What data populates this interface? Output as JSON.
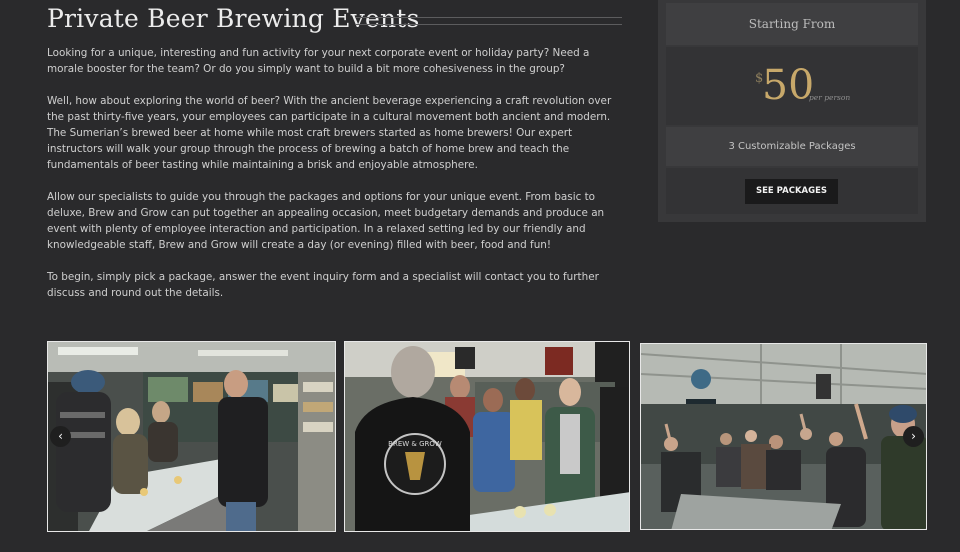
{
  "page": {
    "title": "Private Beer Brewing Events",
    "paragraphs": [
      "Looking for a unique, interesting and fun activity for your next corporate event or holiday party? Need a morale booster for the team? Or do you simply want to build a bit more cohesiveness in the group?",
      "Well, how about exploring the world of beer? With the ancient beverage experiencing a craft revolution over the past thirty-five years, your employees can participate in a cultural movement both ancient and modern. The Sumerian’s brewed beer at home while most craft brewers started as home brewers! Our expert instructors will walk your group through the process of brewing a batch of home brew and teach the fundamentals of beer tasting while maintaining a brisk and enjoyable atmosphere.",
      "Allow our specialists to guide you through the packages and options for your unique event. From basic to deluxe, Brew and Grow can put together an appealing occasion, meet budgetary demands and produce an event with plenty of employee interaction and participation. In a relaxed setting led by our friendly and knowledgeable staff, Brew and Grow will create a day (or evening) filled with beer, food and fun!",
      "To begin, simply pick a package, answer the event inquiry form and a specialist will contact you to further discuss and round out the details."
    ]
  },
  "pricing": {
    "heading": "Starting From",
    "currency": "$",
    "amount": "50",
    "unit": "per person",
    "packages_text": "3 Customizable Packages",
    "cta_label": "SEE PACKAGES"
  },
  "gallery": {
    "prev_icon": "‹",
    "next_icon": "›",
    "shirt_logo": "BREW & GROW"
  },
  "colors": {
    "background": "#2a2a2c",
    "price_accent": "#c7a86a",
    "button_bg": "#1a1a1b"
  }
}
